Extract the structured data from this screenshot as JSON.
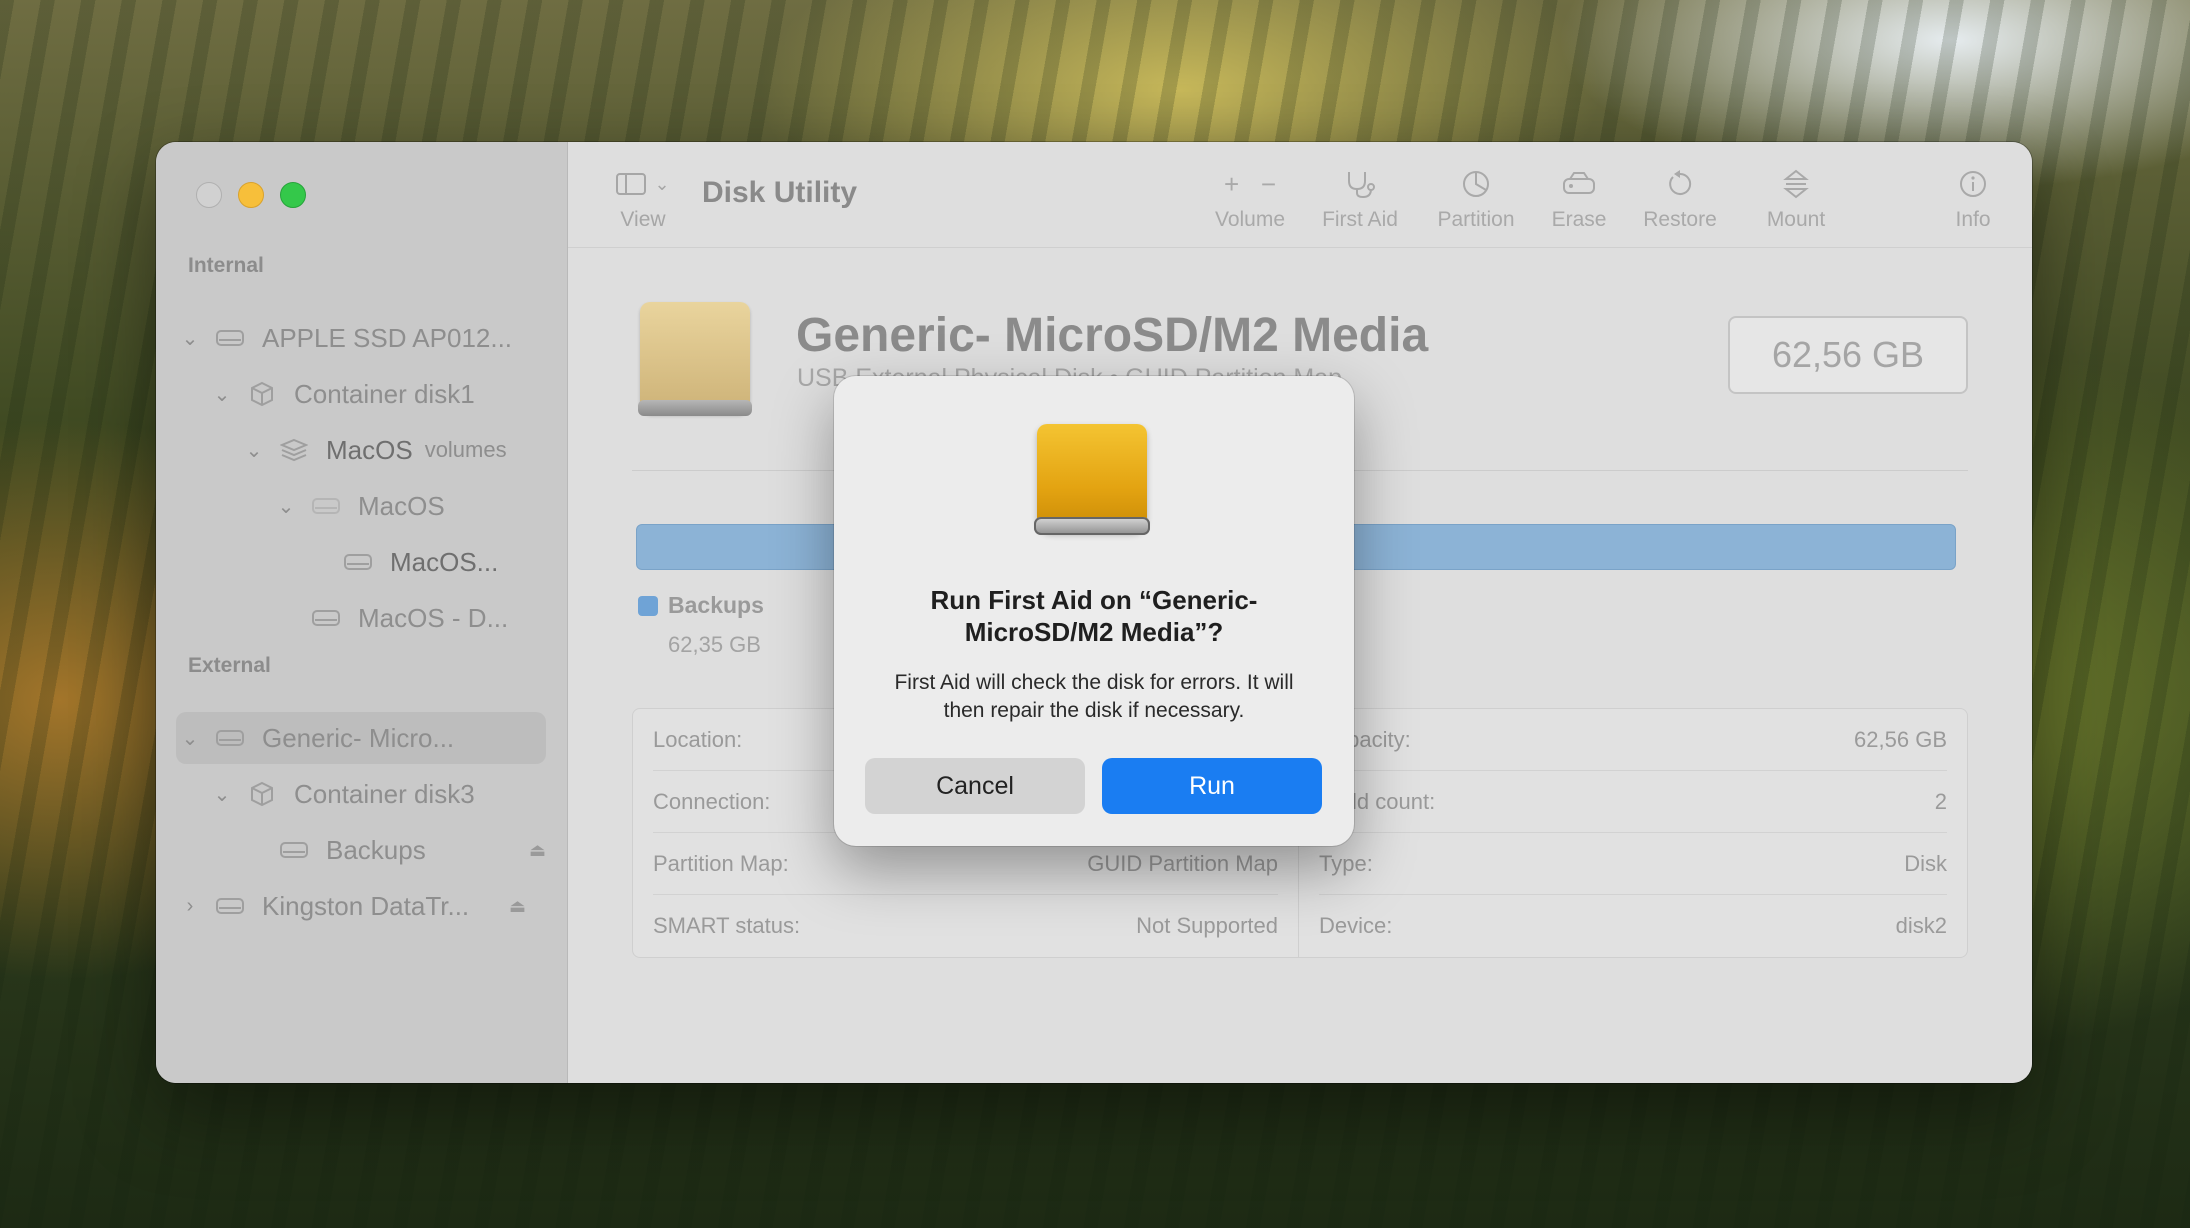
{
  "app": {
    "title": "Disk Utility"
  },
  "toolbar": {
    "view_label": "View",
    "volume_label": "Volume",
    "first_aid_label": "First Aid",
    "partition_label": "Partition",
    "erase_label": "Erase",
    "restore_label": "Restore",
    "mount_label": "Mount",
    "info_label": "Info"
  },
  "sidebar": {
    "internal_header": "Internal",
    "external_header": "External",
    "items": [
      {
        "label": "APPLE SSD AP012..."
      },
      {
        "label": "Container disk1"
      },
      {
        "label": "MacOS",
        "sublabel": "volumes"
      },
      {
        "label": "MacOS"
      },
      {
        "label": "MacOS..."
      },
      {
        "label": "MacOS - D..."
      },
      {
        "label": "Generic- Micro..."
      },
      {
        "label": "Container disk3"
      },
      {
        "label": "Backups"
      },
      {
        "label": "Kingston DataTr..."
      }
    ]
  },
  "disk": {
    "name": "Generic- MicroSD/M2 Media",
    "subtitle": "USB External Physical Disk • GUID Partition Map",
    "size": "62,56 GB"
  },
  "usage": {
    "legend_name": "Backups",
    "legend_size": "62,35 GB",
    "color": "#6fa3d6"
  },
  "info": {
    "left": [
      {
        "key": "Location:",
        "value": ""
      },
      {
        "key": "Connection:",
        "value": ""
      },
      {
        "key": "Partition Map:",
        "value": "GUID Partition Map"
      },
      {
        "key": "SMART status:",
        "value": "Not Supported"
      }
    ],
    "right": [
      {
        "key": "Capacity:",
        "value": "62,56 GB"
      },
      {
        "key": "Child count:",
        "value": "2"
      },
      {
        "key": "Type:",
        "value": "Disk"
      },
      {
        "key": "Device:",
        "value": "disk2"
      }
    ]
  },
  "dialog": {
    "title": "Run First Aid on “Generic-MicroSD/M2 Media”?",
    "message": "First Aid will check the disk for errors. It will then repair the disk if necessary.",
    "cancel_label": "Cancel",
    "run_label": "Run",
    "run_color": "#1a7df2"
  }
}
